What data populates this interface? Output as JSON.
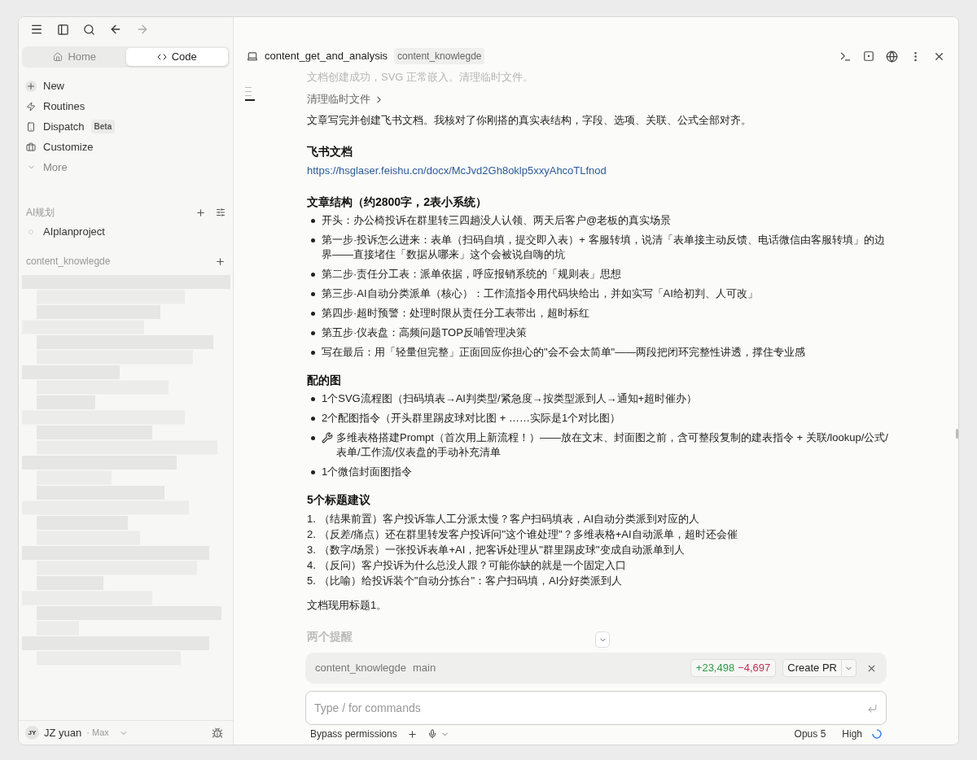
{
  "sidebar": {
    "mode_tabs": [
      {
        "label": "Home",
        "selected": false
      },
      {
        "label": "Code",
        "selected": true
      }
    ],
    "nav": [
      {
        "label": "New"
      },
      {
        "label": "Routines"
      },
      {
        "label": "Dispatch",
        "badge": "Beta"
      },
      {
        "label": "Customize"
      },
      {
        "label": "More"
      }
    ],
    "sections": [
      {
        "title": "AI规划",
        "projects": [
          {
            "label": "AIplanproject"
          }
        ]
      },
      {
        "title": "content_knowlegde"
      }
    ],
    "user": {
      "initials": "JY",
      "name": "JZ yuan",
      "plan": "· Max"
    }
  },
  "header": {
    "title": "content_get_and_analysis",
    "branch": "content_knowlegde"
  },
  "conversation": {
    "faded_line": "文档创建成功，SVG 正常嵌入。清理临时文件。",
    "collapsed_step": "清理临时文件",
    "blocks": [
      {
        "kind": "paragraph",
        "text": "文章写完并创建飞书文档。我核对了你刚搭的真实表结构，字段、选项、关联、公式全部对齐。"
      },
      {
        "kind": "heading",
        "text": "飞书文档"
      },
      {
        "kind": "link",
        "text": "https://hsglaser.feishu.cn/docx/McJvd2Gh8oklp5xxyAhcoTLfnod"
      },
      {
        "kind": "heading",
        "text": "文章结构（约2800字，2表小系统）"
      },
      {
        "kind": "bullets",
        "items": [
          {
            "kind": "text",
            "text": "开头：办公椅投诉在群里转三四趟没人认领、两天后客户@老板的真实场景"
          },
          {
            "kind": "text",
            "text": "第一步·投诉怎么进来：表单（扫码自填，提交即入表）+ 客服转填，说清「表单接主动反馈、电话微信由客服转填」的边界——直接堵住「数据从哪来」这个会被说自嗨的坑"
          },
          {
            "kind": "text",
            "text": "第二步·责任分工表：派单依据，呼应报销系统的「规则表」思想"
          },
          {
            "kind": "text",
            "text": "第三步·AI自动分类派单（核心）：工作流指令用代码块给出，并如实写「AI给初判、人可改」"
          },
          {
            "kind": "text",
            "text": "第四步·超时预警：处理时限从责任分工表带出，超时标红"
          },
          {
            "kind": "text",
            "text": "第五步·仪表盘：高频问题TOP反哺管理决策"
          },
          {
            "kind": "text",
            "text": "写在最后：用「轻量但完整」正面回应你担心的\"会不会太简单\"——两段把闭环完整性讲透，撑住专业感"
          }
        ]
      },
      {
        "kind": "heading",
        "text": "配的图"
      },
      {
        "kind": "bullets",
        "items": [
          {
            "kind": "text",
            "text": "1个SVG流程图（扫码填表→AI判类型/紧急度→按类型派到人→通知+超时催办）"
          },
          {
            "kind": "text",
            "text": "2个配图指令（开头群里踢皮球对比图 + ……实际是1个对比图）"
          },
          {
            "kind": "with_icon",
            "text": "多维表格搭建Prompt（首次用上新流程！）——放在文末、封面图之前，含可整段复制的建表指令 + 关联/lookup/公式/表单/工作流/仪表盘的手动补充清单"
          },
          {
            "kind": "text",
            "text": "1个微信封面图指令"
          }
        ]
      },
      {
        "kind": "heading",
        "text": "5个标题建议"
      },
      {
        "kind": "numbered",
        "items": [
          {
            "number": "1.",
            "text": "（结果前置）客户投诉靠人工分派太慢？客户扫码填表，AI自动分类派到对应的人"
          },
          {
            "number": "2.",
            "text": "（反差/痛点）还在群里转发客户投诉问\"这个谁处理\"？多维表格+AI自动派单，超时还会催"
          },
          {
            "number": "3.",
            "text": "（数字/场景）一张投诉表单+AI，把客诉处理从\"群里踢皮球\"变成自动派单到人"
          },
          {
            "number": "4.",
            "text": "（反问）客户投诉为什么总没人跟？可能你缺的就是一个固定入口"
          },
          {
            "number": "5.",
            "text": "（比喻）给投诉装个\"自动分拣台\"：客户扫码填，AI分好类派到人"
          }
        ]
      },
      {
        "kind": "paragraph",
        "text": "文档现用标题1。"
      },
      {
        "kind": "faded_heading",
        "text": "两个提醒"
      }
    ]
  },
  "composer": {
    "repo": "content_knowlegde",
    "branch": "main",
    "added": "+23,498",
    "removed": "−4,697",
    "pr_button": "Create PR",
    "placeholder": "Type / for commands",
    "permissions": "Bypass permissions",
    "model": "Opus 5",
    "effort": "High"
  }
}
